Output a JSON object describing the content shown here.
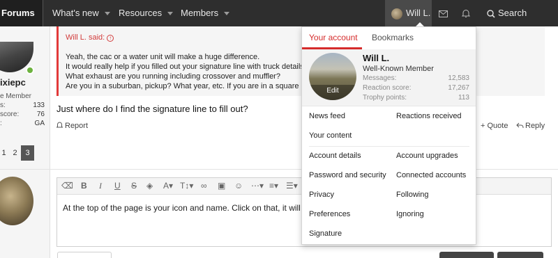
{
  "nav": {
    "forums": "Forums",
    "whats_new": "What's new",
    "resources": "Resources",
    "members": "Members",
    "account_name": "Will L.",
    "search": "Search"
  },
  "post": {
    "author": "ixiepc",
    "author_title": "e Member",
    "stats": [
      {
        "label": "s:",
        "value": "133"
      },
      {
        "label": "score:",
        "value": "76"
      },
      {
        "label": ":",
        "value": "GA"
      }
    ],
    "quote_author": "Will L. said:",
    "quote_lines": [
      "Yeah, the cac or a water unit will make a huge difference.",
      "It would really help if you filled out your signature line with truck details.",
      "What exhaust are you running including crossover and muffler?",
      "Are you in a suburban, pickup? What year, etc. If you are in a square body it"
    ],
    "message": "Just where do I find the signature line to fill out?",
    "report": "Report",
    "quote": "+ Quote",
    "reply": "Reply"
  },
  "pagination": [
    "1",
    "2",
    "3"
  ],
  "editor": {
    "text": "At the top of the page is your icon and name. Click on that, it will b"
  },
  "account_menu": {
    "tab_account": "Your account",
    "tab_bookmarks": "Bookmarks",
    "name": "Will L.",
    "title": "Well-Known Member",
    "edit": "Edit",
    "stats": [
      {
        "label": "Messages:",
        "value": "12,583"
      },
      {
        "label": "Reaction score:",
        "value": "17,267"
      },
      {
        "label": "Trophy points:",
        "value": "113"
      }
    ],
    "links": {
      "news_feed": "News feed",
      "reactions_received": "Reactions received",
      "your_content": "Your content",
      "account_details": "Account details",
      "account_upgrades": "Account upgrades",
      "password_security": "Password and security",
      "connected_accounts": "Connected accounts",
      "privacy": "Privacy",
      "following": "Following",
      "preferences": "Preferences",
      "ignoring": "Ignoring",
      "signature": "Signature"
    }
  },
  "colors": {
    "nav_bg": "#2e2e2e",
    "accent": "#d52b2b",
    "online": "#6db23f"
  }
}
